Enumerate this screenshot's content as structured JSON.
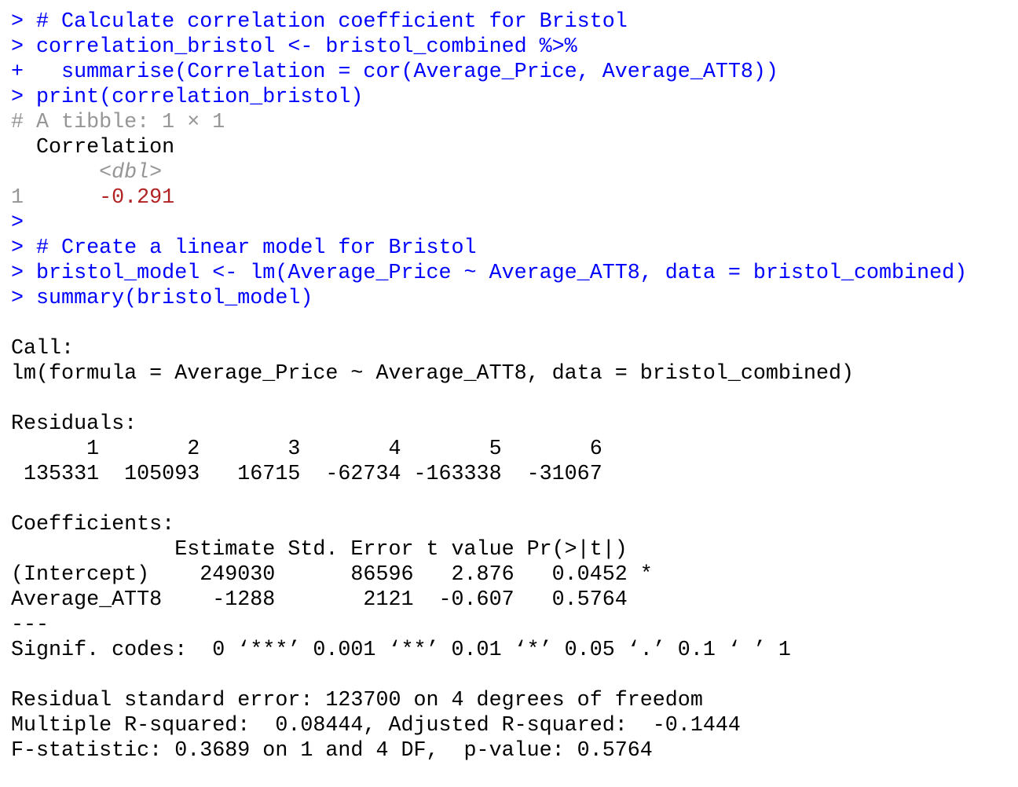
{
  "console": {
    "prompt": ">",
    "continuation": "+",
    "lines": [
      {
        "kind": "input",
        "prefix": ">",
        "text": ""
      },
      {
        "kind": "input",
        "prefix": ">",
        "text": "# Calculate correlation coefficient for Bristol"
      },
      {
        "kind": "input",
        "prefix": ">",
        "text": "correlation_bristol <- bristol_combined %>%"
      },
      {
        "kind": "input",
        "prefix": "+",
        "text": "  summarise(Correlation = cor(Average_Price, Average_ATT8))"
      },
      {
        "kind": "input",
        "prefix": ">",
        "text": "print(correlation_bristol)"
      },
      {
        "kind": "tibble-header",
        "text": "# A tibble: 1 × 1"
      },
      {
        "kind": "output",
        "text": "  Correlation"
      },
      {
        "kind": "type",
        "text": "       <dbl>"
      },
      {
        "kind": "row",
        "index": "1",
        "pad": "      ",
        "value": "-0.291"
      },
      {
        "kind": "input",
        "prefix": ">",
        "text": ""
      },
      {
        "kind": "input",
        "prefix": ">",
        "text": "# Create a linear model for Bristol"
      },
      {
        "kind": "input",
        "prefix": ">",
        "text": "bristol_model <- lm(Average_Price ~ Average_ATT8, data = bristol_combined)"
      },
      {
        "kind": "input",
        "prefix": ">",
        "text": "summary(bristol_model)"
      },
      {
        "kind": "output",
        "text": ""
      },
      {
        "kind": "output",
        "text": "Call:"
      },
      {
        "kind": "output",
        "text": "lm(formula = Average_Price ~ Average_ATT8, data = bristol_combined)"
      },
      {
        "kind": "output",
        "text": ""
      },
      {
        "kind": "output",
        "text": "Residuals:"
      },
      {
        "kind": "output",
        "text": "      1       2       3       4       5       6 "
      },
      {
        "kind": "output",
        "text": " 135331  105093   16715  -62734 -163338  -31067 "
      },
      {
        "kind": "output",
        "text": ""
      },
      {
        "kind": "output",
        "text": "Coefficients:"
      },
      {
        "kind": "output",
        "text": "             Estimate Std. Error t value Pr(>|t|)  "
      },
      {
        "kind": "output",
        "text": "(Intercept)    249030      86596   2.876   0.0452 *"
      },
      {
        "kind": "output",
        "text": "Average_ATT8    -1288       2121  -0.607   0.5764  "
      },
      {
        "kind": "output",
        "text": "---"
      },
      {
        "kind": "output",
        "text": "Signif. codes:  0 ‘***’ 0.001 ‘**’ 0.01 ‘*’ 0.05 ‘.’ 0.1 ‘ ’ 1"
      },
      {
        "kind": "output",
        "text": ""
      },
      {
        "kind": "output",
        "text": "Residual standard error: 123700 on 4 degrees of freedom"
      },
      {
        "kind": "output",
        "text": "Multiple R-squared:  0.08444,\tAdjusted R-squared:  -0.1444 "
      },
      {
        "kind": "output",
        "text": "F-statistic: 0.3689 on 1 and 4 DF,  p-value: 0.5764"
      }
    ]
  },
  "colors": {
    "input": "#0000ff",
    "output": "#000000",
    "dim": "#969696",
    "negative": "#b22222",
    "background": "#ffffff"
  }
}
